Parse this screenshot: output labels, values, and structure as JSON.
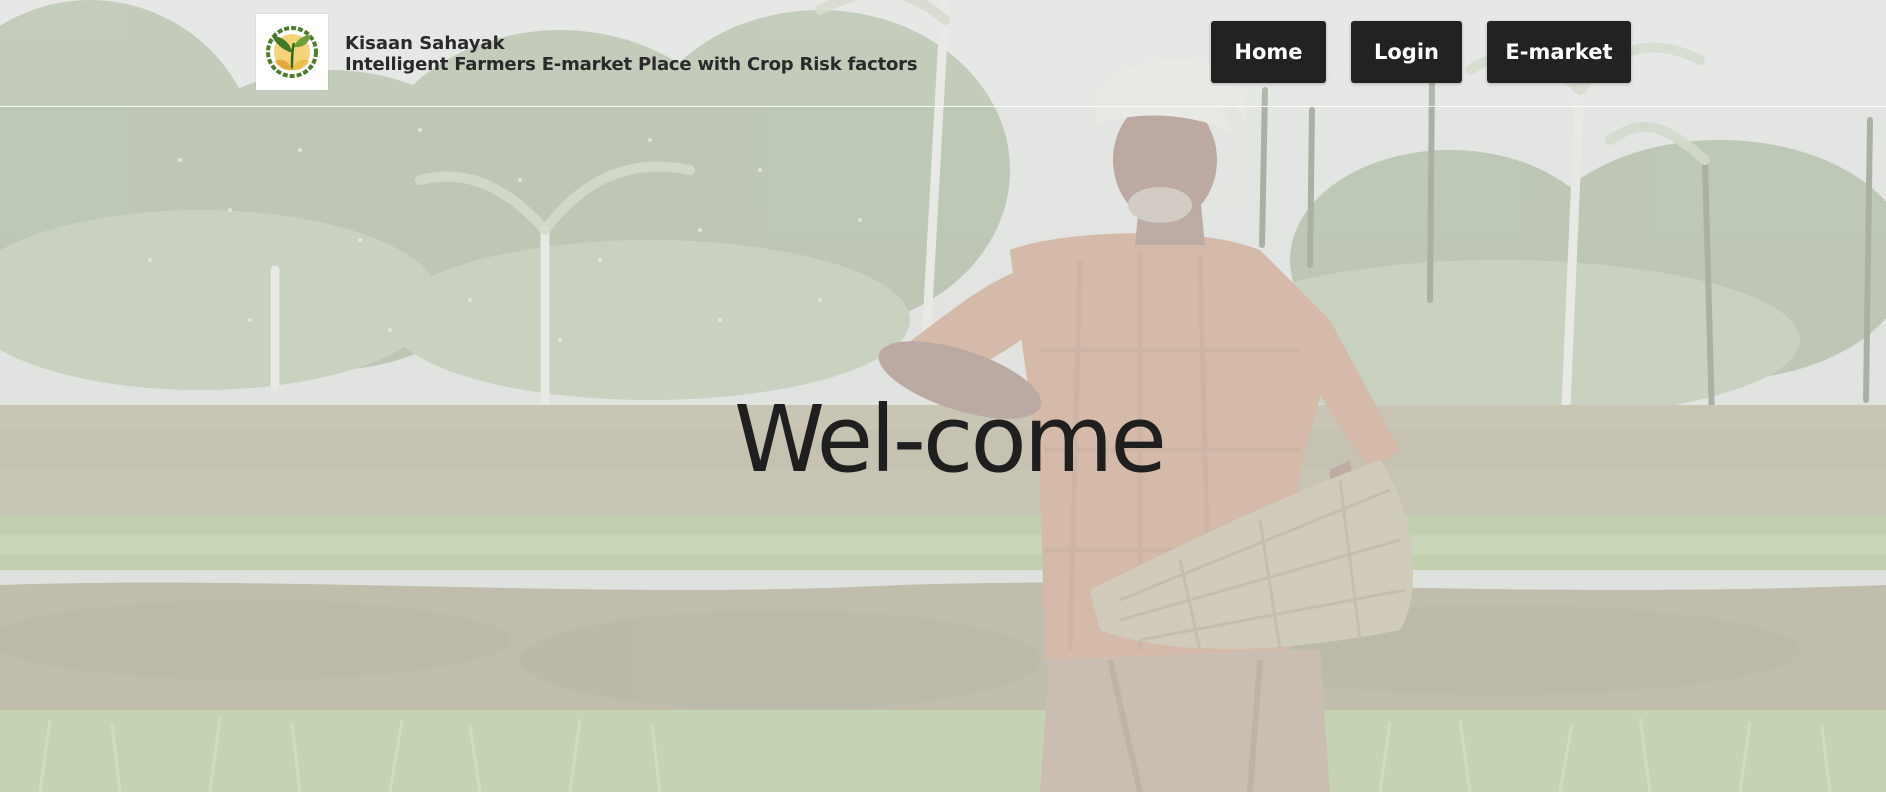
{
  "header": {
    "brand_name": "Kisaan Sahayak",
    "brand_tagline": "Intelligent Farmers E-market Place with Crop Risk factors",
    "logo_icon": "leaf-circle-logo-icon"
  },
  "nav": {
    "items": [
      {
        "label": "Home"
      },
      {
        "label": "Login"
      },
      {
        "label": "E-market"
      }
    ],
    "button_color": "#222222",
    "text_color": "#ffffff"
  },
  "hero": {
    "title": "Wel-come",
    "background": "farmer-sowing-seeds-in-rice-field-photo"
  }
}
